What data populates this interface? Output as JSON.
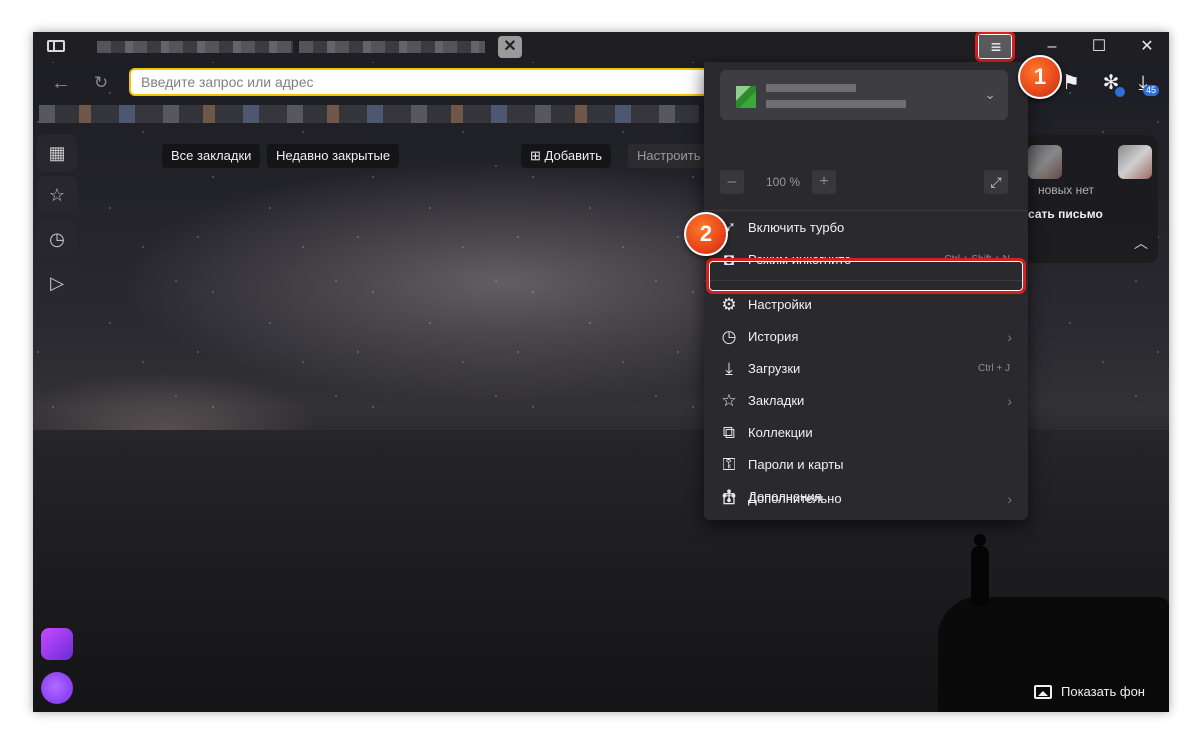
{
  "toolbar": {
    "address_placeholder": "Введите запрос или адрес",
    "back_icon": "arrow-left-icon",
    "reload_icon": "reload-icon",
    "downloads_badge": "45"
  },
  "window_controls": {
    "menu_icon": "≡",
    "minimize": "–",
    "maximize": "☐",
    "close": "✕"
  },
  "tab_close": "✕",
  "newtab": {
    "all_bookmarks": "Все закладки",
    "recently_closed": "Недавно закрытые",
    "add": "Добавить",
    "configure": "Настроить",
    "mail_no_new": "новых нет",
    "mail_write": "сать письмо",
    "show_background": "Показать фон"
  },
  "menu": {
    "zoom": "100 %",
    "zoom_minus": "–",
    "zoom_plus": "+",
    "items": [
      {
        "label": "Включить турбо",
        "icon": "rocket-icon",
        "hint": "",
        "arrow": ""
      },
      {
        "label": "Режим инкогнито",
        "icon": "incognito-icon",
        "hint": "Ctrl + Shift + N",
        "arrow": ""
      },
      {
        "label": "Настройки",
        "icon": "gear-icon",
        "hint": "",
        "arrow": ""
      },
      {
        "label": "История",
        "icon": "clock-icon",
        "hint": "",
        "arrow": "›"
      },
      {
        "label": "Загрузки",
        "icon": "download-icon",
        "hint": "Ctrl + J",
        "arrow": ""
      },
      {
        "label": "Закладки",
        "icon": "star-icon",
        "hint": "",
        "arrow": "›"
      },
      {
        "label": "Коллекции",
        "icon": "collections-icon",
        "hint": "",
        "arrow": ""
      },
      {
        "label": "Пароли и карты",
        "icon": "passwords-icon",
        "hint": "",
        "arrow": ""
      },
      {
        "label": "Дополнения",
        "icon": "puzzle-icon",
        "hint": "",
        "arrow": ""
      },
      {
        "label": "Дополнительно",
        "icon": "more-icon",
        "hint": "",
        "arrow": "›"
      }
    ]
  },
  "steps": {
    "one": "1",
    "two": "2"
  },
  "colors": {
    "highlight": "#d61f1f",
    "step_marker": "#e8451a",
    "address_border": "#f2c400"
  }
}
